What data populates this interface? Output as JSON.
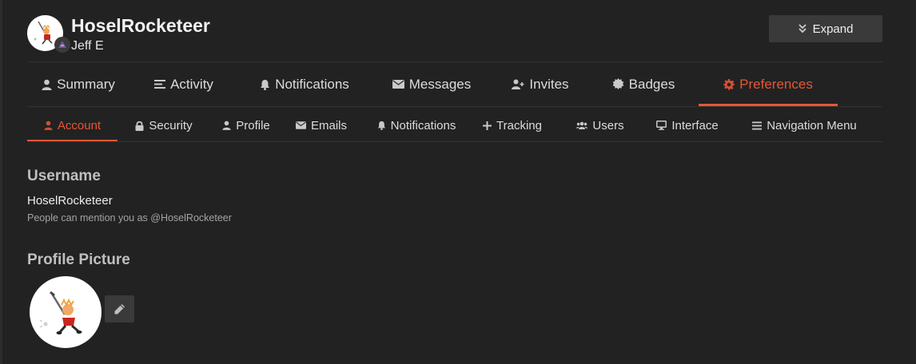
{
  "user": {
    "username": "HoselRocketeer",
    "full_name": "Jeff E"
  },
  "header": {
    "expand_label": "Expand"
  },
  "nav_primary": [
    {
      "label": "Summary",
      "icon": "user-icon",
      "active": false
    },
    {
      "label": "Activity",
      "icon": "list-icon",
      "active": false
    },
    {
      "label": "Notifications",
      "icon": "bell-icon",
      "active": false
    },
    {
      "label": "Messages",
      "icon": "envelope-icon",
      "active": false
    },
    {
      "label": "Invites",
      "icon": "user-plus-icon",
      "active": false
    },
    {
      "label": "Badges",
      "icon": "certificate-icon",
      "active": false
    },
    {
      "label": "Preferences",
      "icon": "gear-icon",
      "active": true
    }
  ],
  "nav_secondary": [
    {
      "label": "Account",
      "icon": "user-icon",
      "active": true
    },
    {
      "label": "Security",
      "icon": "lock-icon",
      "active": false
    },
    {
      "label": "Profile",
      "icon": "user-icon",
      "active": false
    },
    {
      "label": "Emails",
      "icon": "envelope-icon",
      "active": false
    },
    {
      "label": "Notifications",
      "icon": "bell-icon",
      "active": false
    },
    {
      "label": "Tracking",
      "icon": "plus-icon",
      "active": false
    },
    {
      "label": "Users",
      "icon": "users-icon",
      "active": false
    },
    {
      "label": "Interface",
      "icon": "desktop-icon",
      "active": false
    },
    {
      "label": "Navigation Menu",
      "icon": "bars-icon",
      "active": false
    }
  ],
  "account": {
    "username_heading": "Username",
    "username_value": "HoselRocketeer",
    "mention_hint": "People can mention you as @HoselRocketeer",
    "profile_picture_heading": "Profile Picture"
  },
  "colors": {
    "background": "#222222",
    "accent": "#e45735",
    "button_bg": "#3a3a3a"
  }
}
